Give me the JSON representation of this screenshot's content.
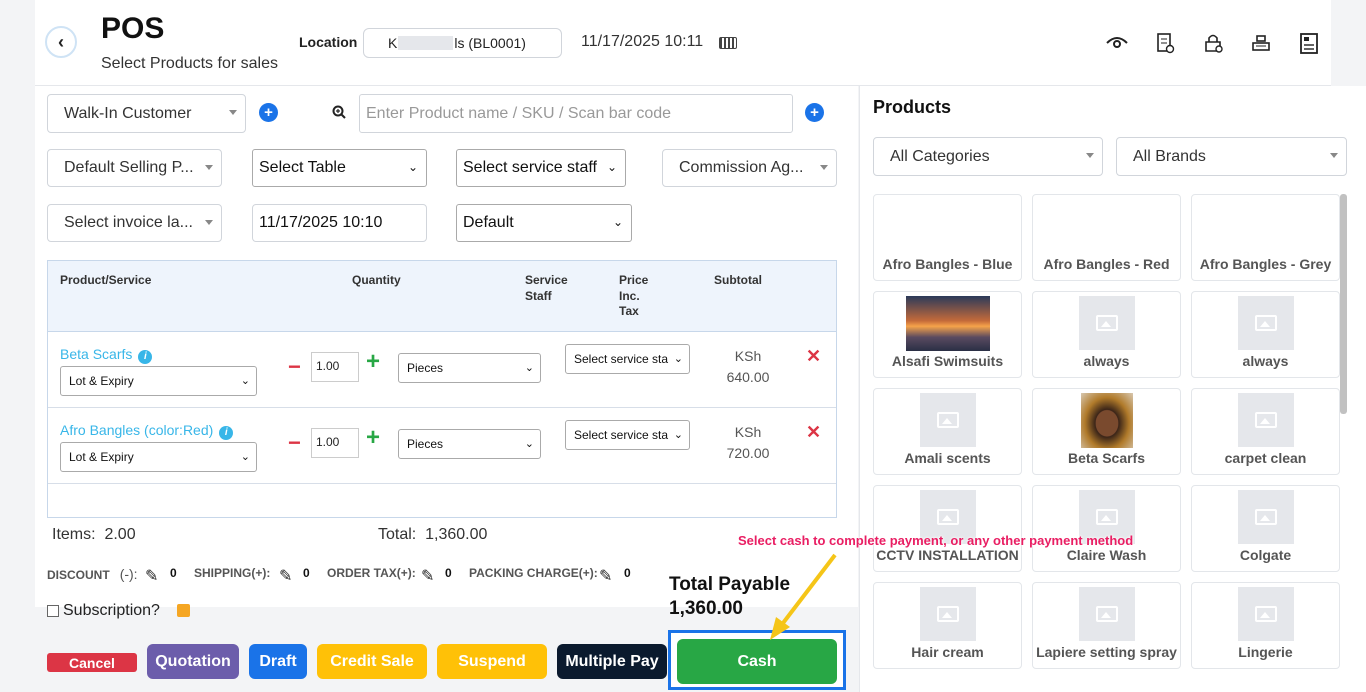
{
  "header": {
    "title": "POS",
    "subtitle": "Select Products for sales",
    "location_label": "Location",
    "location_prefix": "K",
    "location_suffix": "ls (BL0001)",
    "datetime": "11/17/2025 10:11"
  },
  "form": {
    "customer": "Walk-In Customer",
    "search_placeholder": "Enter Product name / SKU / Scan bar code",
    "selling_price": "Default Selling P...",
    "table": "Select Table",
    "service_staff": "Select service staff",
    "commission_agent": "Commission Ag...",
    "invoice_layout": "Select invoice la...",
    "date": "11/17/2025 10:10",
    "default": "Default"
  },
  "table": {
    "headers": {
      "product": "Product/Service",
      "quantity": "Quantity",
      "staff1": "Service",
      "staff2": "Staff",
      "price1": "Price",
      "price2": "Inc.",
      "price3": "Tax",
      "subtotal": "Subtotal"
    },
    "rows": [
      {
        "name": "Beta Scarfs",
        "lot": "Lot & Expiry",
        "qty": "1.00",
        "unit": "Pieces",
        "staff": "Select service sta",
        "currency": "KSh",
        "amount": "640.00"
      },
      {
        "name": "Afro Bangles (color:Red)",
        "lot": "Lot & Expiry",
        "qty": "1.00",
        "unit": "Pieces",
        "staff": "Select service sta",
        "currency": "KSh",
        "amount": "720.00"
      }
    ]
  },
  "summary": {
    "items_label": "Items:",
    "items": "2.00",
    "total_label": "Total:",
    "total": "1,360.00",
    "discount": "DISCOUNT",
    "discount_sign": "(-):",
    "discount_val": "0",
    "shipping": "SHIPPING(+):",
    "shipping_val": "0",
    "tax": "ORDER TAX(+):",
    "tax_val": "0",
    "packing": "PACKING CHARGE(+):",
    "packing_val": "0",
    "subscription": "Subscription?",
    "payable_label": "Total Payable",
    "payable": "1,360.00"
  },
  "buttons": {
    "cancel": "Cancel",
    "quotation": "Quotation",
    "draft": "Draft",
    "credit": "Credit Sale",
    "suspend": "Suspend",
    "multiple": "Multiple Pay",
    "cash": "Cash"
  },
  "colors": {
    "cancel": "#dc3545",
    "quotation": "#6c5dab",
    "draft": "#1a73e8",
    "credit": "#ffc107",
    "suspend": "#ffc107",
    "multiple": "#0b1a2e",
    "cash": "#28a745",
    "highlight": "#1a73e8",
    "tip": "#e91e63"
  },
  "products": {
    "title": "Products",
    "category": "All Categories",
    "brand": "All Brands",
    "items": [
      {
        "name": "Afro Bangles - Blue",
        "image": "none"
      },
      {
        "name": "Afro Bangles - Red",
        "image": "none"
      },
      {
        "name": "Afro Bangles - Grey",
        "image": "none"
      },
      {
        "name": "Alsafi Swimsuits",
        "image": "sunset-photo"
      },
      {
        "name": "always",
        "image": "placeholder"
      },
      {
        "name": "always",
        "image": "placeholder"
      },
      {
        "name": "Amali scents",
        "image": "placeholder"
      },
      {
        "name": "Beta Scarfs",
        "image": "portrait-photo"
      },
      {
        "name": "carpet clean",
        "image": "placeholder"
      },
      {
        "name": "CCTV INSTALLATION",
        "image": "placeholder"
      },
      {
        "name": "Claire Wash",
        "image": "placeholder"
      },
      {
        "name": "Colgate",
        "image": "placeholder"
      },
      {
        "name": "Hair cream",
        "image": "placeholder"
      },
      {
        "name": "Lapiere setting spray",
        "image": "placeholder"
      },
      {
        "name": "Lingerie",
        "image": "placeholder"
      }
    ]
  },
  "annotation": {
    "tip": "Select cash to complete payment, or any other payment method"
  }
}
